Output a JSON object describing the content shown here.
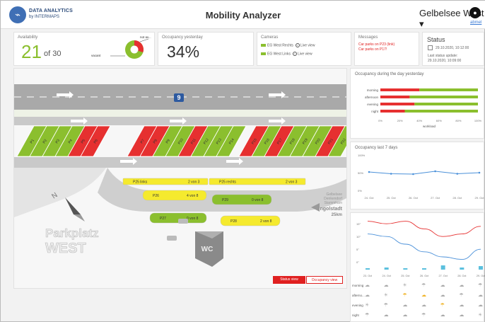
{
  "header": {
    "brand_line1": "DATA ANALYTICS",
    "brand_line2": "by INTERMAPS",
    "title": "Mobility Analyzer",
    "location_select": "Gelbelsee West",
    "logout": "abmel"
  },
  "availability": {
    "label": "Availability",
    "free": "21",
    "of_total": "of 30",
    "pie_label_top": "not av...",
    "pie_label_bottom": "vacant",
    "occupied_fraction": 0.3
  },
  "occupancy_yesterday": {
    "label": "Occupancy yesterday",
    "value": "34%"
  },
  "cameras": {
    "label": "Cameras",
    "items": [
      {
        "name": "EG West Rechts",
        "action": "Live view"
      },
      {
        "name": "EG West Links",
        "action": "Live view"
      }
    ]
  },
  "messages": {
    "label": "Messages",
    "items": [
      "Car parks on P23 (link)",
      "Car parks on P17!"
    ]
  },
  "status": {
    "title": "Status",
    "date_time": "29.10.2020, 10:12:00",
    "last_update_label": "Last status update:",
    "last_update": "29.10.2020, 10:09:00"
  },
  "map": {
    "road_number": "9",
    "parking_title_1": "Parkplatz",
    "parking_title_2": "WEST",
    "wc_label": "WC",
    "direction_line1": "Gelbelsee",
    "direction_line2": "Denkendorf",
    "direction_line3": "Stammham",
    "direction_line4": "Ingolstadt",
    "direction_line5": "25km",
    "spots_left": [
      "P1",
      "P2",
      "P3",
      "P4",
      "P5",
      "P6"
    ],
    "spots_middle": [
      "P7",
      "P8",
      "P9",
      "P10",
      "P11",
      "P12",
      "P13",
      "P14"
    ],
    "spots_right": [
      "P15",
      "P16",
      "P17",
      "P18",
      "P19",
      "P20",
      "P21",
      "P22"
    ],
    "zones": [
      {
        "name": "P25 links",
        "count": "2 von 3"
      },
      {
        "name": "P25 rechts",
        "count": "2 von 3"
      },
      {
        "name": "P26",
        "count": "4 von 8"
      },
      {
        "name": "P29",
        "count": "0 von 8"
      },
      {
        "name": "P27",
        "count": "0 von 8"
      },
      {
        "name": "P28",
        "count": "2 von 8"
      }
    ],
    "btn_status": "Status view",
    "btn_occupancy": "Occupancy view"
  },
  "day_chart": {
    "title": "Occupancy during the day yesterday",
    "xlabel": "workload",
    "ticks": [
      "0%",
      "20%",
      "40%",
      "60%",
      "80%",
      "100%"
    ]
  },
  "week_chart": {
    "title": "Occupancy last 7 days",
    "ylabels": [
      "100%",
      "50%",
      "0%"
    ],
    "dates": [
      "24. Oct",
      "25. Oct",
      "26. Oct",
      "27. Oct",
      "28. Oct",
      "29. Oct"
    ]
  },
  "weather": {
    "ylabels": [
      "15°",
      "10°",
      "5°",
      "0°"
    ],
    "dates": [
      "23. Oct",
      "24. Oct",
      "25. Oct",
      "26. Oct",
      "27. Oct",
      "28. Oct",
      "29. Oct"
    ],
    "row_labels": [
      "morning",
      "afterno...",
      "evening",
      "night"
    ]
  },
  "chart_data": [
    {
      "type": "bar",
      "title": "Occupancy during the day yesterday",
      "xlabel": "workload",
      "categories": [
        "morning",
        "afternoon",
        "evening",
        "night"
      ],
      "series": [
        {
          "name": "occupied",
          "values": [
            40,
            30,
            35,
            25
          ]
        },
        {
          "name": "free",
          "values": [
            60,
            70,
            65,
            75
          ]
        }
      ],
      "xlim": [
        0,
        100
      ],
      "colors": [
        "#e63030",
        "#8bbf2e"
      ]
    },
    {
      "type": "line",
      "title": "Occupancy last 7 days",
      "x": [
        "24. Oct",
        "25. Oct",
        "26. Oct",
        "27. Oct",
        "28. Oct",
        "29. Oct"
      ],
      "series": [
        {
          "values": [
            52,
            47,
            46,
            54,
            47,
            50
          ]
        }
      ],
      "ylim": [
        0,
        100
      ],
      "color": "#4a90d9"
    },
    {
      "type": "line",
      "x": [
        "23. Oct",
        "24. Oct",
        "25. Oct",
        "26. Oct",
        "27. Oct",
        "28. Oct",
        "29. Oct"
      ],
      "series": [
        {
          "values": [
            16,
            15,
            16,
            13,
            10,
            11,
            14
          ]
        },
        {
          "values": [
            11,
            10,
            7,
            4,
            2,
            1,
            5
          ]
        }
      ],
      "ylim": [
        -3,
        17
      ]
    }
  ],
  "colors": {
    "green": "#8bbf2e",
    "red": "#e63030",
    "yellow": "#f5ea2e",
    "blue": "#4a90d9",
    "brand": "#3f6fb5"
  }
}
